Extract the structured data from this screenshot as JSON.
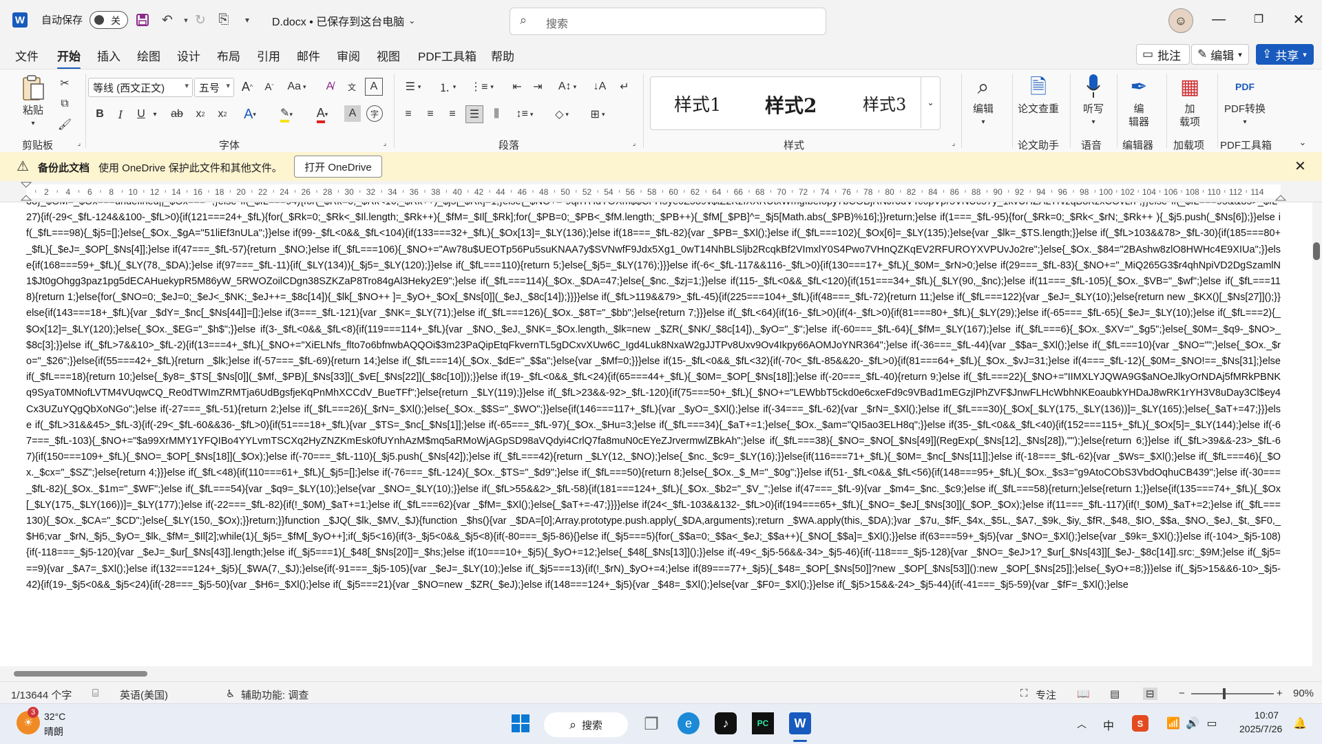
{
  "titlebar": {
    "app_letter": "W",
    "autosave_label": "自动保存",
    "autosave_state": "关",
    "doc_title": "D.docx • 已保存到这台电脑",
    "search_placeholder": "搜索"
  },
  "tabs": [
    "文件",
    "开始",
    "插入",
    "绘图",
    "设计",
    "布局",
    "引用",
    "邮件",
    "审阅",
    "视图",
    "PDF工具箱",
    "帮助"
  ],
  "active_tab": "开始",
  "right_buttons": {
    "comment": "批注",
    "edit": "编辑",
    "share": "共享"
  },
  "ribbon": {
    "paste": "粘贴",
    "font_name": "等线 (西文正文)",
    "font_size": "五号",
    "style_items": [
      "样式1",
      "样式2",
      "样式3"
    ],
    "edit_btn": "编辑",
    "paper_check": "论文查重",
    "dictate": "听写",
    "editor_line1": "编",
    "editor_line2": "辑器",
    "addins_line1": "加",
    "addins_line2": "载项",
    "pdf_convert": "PDF转换",
    "groups": {
      "clipboard": "剪贴板",
      "font": "字体",
      "paragraph": "段落",
      "styles": "样式",
      "paper": "论文助手",
      "voice": "语音",
      "editor": "编辑器",
      "addins": "加载项",
      "pdf": "PDF工具箱"
    }
  },
  "infobar": {
    "title": "备份此文档",
    "text": "使用 OneDrive 保护此文件和其他文件。",
    "button": "打开 OneDrive"
  },
  "ruler": {
    "labels": [
      "2",
      "4",
      "6",
      "8",
      "10",
      "12",
      "14",
      "16",
      "18",
      "20",
      "22",
      "24",
      "26",
      "28",
      "30",
      "32",
      "34",
      "36",
      "38",
      "40",
      "42",
      "44",
      "46",
      "48",
      "50",
      "52",
      "54",
      "56",
      "58",
      "60",
      "62",
      "64",
      "66",
      "68",
      "70",
      "72",
      "74",
      "76",
      "78",
      "80",
      "82",
      "84",
      "86",
      "88",
      "90",
      "92",
      "94",
      "96",
      "98",
      "100",
      "102",
      "104",
      "106",
      "108",
      "110",
      "112",
      "114"
    ]
  },
  "document": {
    "text": "38}_$OM=_$Ox===undefined||_$Ox===``;}else if(_$fL===94){for(_$Rk=0;_$Rk<16;_$Rk++)_$j5[_$Rk]=1;}else{_$NO+=\"9qnTHdYOXm$$CFH5ye0Z589v$tZ2KzIXXRUtxWmgIbeIopy7bCOBjRNJr3dVTc6pVpr5VNUc57y_1kvUHZALYrvzqB8KzxCOvLn\";}}else if(_$fL===95&&85>_$fL-27){if(-29<_$fL-124&&100-_$fL>0){if(121===24+_$fL){for(_$Rk=0;_$Rk<_$Il.length;_$Rk++){_$fM=_$Il[_$Rk];for(_$PB=0;_$PB<_$fM.length;_$PB++){_$fM[_$PB]^=_$j5[Math.abs(_$PB)%16];}}return;}else if(1===_$fL-95){for(_$Rk=0;_$Rk<_$rN;_$Rk++ ){_$j5.push(_$Ns[6]);}}else if(_$fL===98){_$j5=[];}else{_$Ox._$gA=\"51liEf3nULa\";}}else if(99-_$fL<0&&_$fL<104){if(133===32+_$fL){_$Ox[13]=_$LY(136);}else if(18===_$fL-82){var _$PB=_$Xl();}else if(_$fL===102){_$Ox[6]=_$LY(135);}else{var _$lk=_$TS.length;}}else if(_$fL>103&&78>_$fL-30){if(185===80+_$fL){_$eJ=_$OP[_$Ns[4]];}else if(47===_$fL-57){return _$NO;}else if(_$fL===106){_$NO+=\"Aw78u$UEOTp56Pu5suKNAA7y$SVNwfF9Jdx5Xg1_0wT14NhBLSljb2RcqkBf2VImxlY0S4Pwo7VHnQZKqEV2RFUROYXVPUvJo2re\";}else{_$Ox._$84=\"2BAshw8zlO8HWHc4E9XIUa\";}}else{if(168===59+_$fL){_$LY(78,_$DA);}else if(97===_$fL-11){if(_$LY(134)){_$j5=_$LY(120);}}else if(_$fL===110){return 5;}else{_$j5=_$LY(176);}}}else if(-6<_$fL-117&&116-_$fL>0){if(130===17+_$fL){_$0M=_$rN>0;}else if(29===_$fL-83){_$NO+=\"_MiQ265G3$r4qhNpiVD2DgSzamlN1$Jt0gOhgg3paz1pg5dECAHuekypR5M86yW_5RWOZoilCDgn38SZKZaP8Tro84gAl3Heky2E9\";}else if(_$fL===114){_$Ox._$DA=47;}else{_$nc._$zj=1;}}else if(115-_$fL<0&&_$fL<120){if(151===34+_$fL){_$LY(90,_$nc);}else if(11===_$fL-105){_$Ox._$VB=\"_$wf\";}else if(_$fL===118){return 1;}else{for(_$NO=0;_$eJ=0;_$eJ<_$NK;_$eJ++=_$8c[14]){_$lk[_$NO++ ]=_$yO+_$Ox[_$Ns[0]](_$eJ,_$8c[14]);}}}}else if(_$fL>119&&79>_$fL-45){if(225===104+_$fL){if(48===_$fL-72){return 11;}else if(_$fL===122){var _$eJ=_$LY(10);}else{return new _$KX()[_$Ns[27]]();}}else{if(143===18+_$fL){var _$dY=_$nc[_$Ns[44]]=[];}else if(3===_$fL-121){var _$NK=_$LY(71);}else if(_$fL===126){_$Ox._$8T=\"_$bb\";}else{return 7;}}}else if(_$fL<64){if(16-_$fL>0){if(4-_$fL>0){if(81===80+_$fL){_$LY(29);}else if(-65===_$fL-65){_$eJ=_$LY(10);}else if(_$fL===2){_$Ox[12]=_$LY(120);}else{_$Ox._$EG=\"_$h$\";}}else if(3-_$fL<0&&_$fL<8){if(119===114+_$fL){var _$NO,_$eJ,_$NK=_$Ox.length,_$lk=new _$ZR(_$NK/_$8c[14]),_$yO=\"_$\";}else if(-60===_$fL-64){_$fM=_$LY(167);}else if(_$fL===6){_$Ox._$XV=\"_$g5\";}else{_$0M=_$q9-_$NO>_$8c[3];}}else if(_$fL>7&&10>_$fL-2){if(13===4+_$fL){_$NO+=\"XiELNfs_flto7o6bfnwbAQQOi$3m23PaQipEtqFkvernTL5gDCxvXUw6C_Igd4Luk8NxaW2gJJTPv8Uxv9Ov4Ikpy66AOMJoYNR364\";}else if(-36===_$fL-44){var _$$a=_$Xl();}else if(_$fL===10){var _$NO=\"\";}else{_$Ox._$ro=\"_$26\";}}else{if(55===42+_$fL){return _$lk;}else if(-57===_$fL-69){return 14;}else if(_$fL===14){_$Ox._$dE=\"_$$a\";}else{var _$Mf=0;}}}else if(15-_$fL<0&&_$fL<32){if(-70<_$fL-85&&20-_$fL>0){if(81===64+_$fL){_$Ox._$vJ=31;}else if(4===_$fL-12){_$0M=_$NO!==_$Ns[31];}else if(_$fL===18){return 10;}else{_$y8=_$TS[_$Ns[0]](_$Mf,_$PB)[_$Ns[33]](_$vE[_$Ns[22]](_$8c[10]));}}else if(19-_$fL<0&&_$fL<24){if(65===44+_$fL){_$0M=_$OP[_$Ns[18]];}else if(-20===_$fL-40){return 9;}else if(_$fL===22){_$NO+=\"IIMXLYJQWA9G$aNOeJlkyOrNDAj5fMRkPBNKq9SyaT0MNofLVTM4VUqwCQ_Re0dTWImZRMTja6UdBgsfjeKqPnMhXCCdV_BueTFf\";}else{return _$LY(119);}}else if(_$fL>23&&-92>_$fL-120){if(75===50+_$fL){_$NO+=\"LEWbbT5ckd0e6cxeFd9c9VBad1mEGzjlPhZVF$JnwFLHcWbhNKEoaubkYHDaJ8wRK1rYH3V8uDay3Cl$ey4Cx3UZuYQgQbXoNGo\";}else if(-27===_$fL-51){return 2;}else if(_$fL===26){_$rN=_$Xl();}else{_$Ox._$$S=\"_$WO\";}}else{if(146===117+_$fL){var _$yO=_$Xl();}else if(-34===_$fL-62){var _$rN=_$Xl();}else if(_$fL===30){_$Ox[_$LY(175,_$LY(136))]=_$LY(165);}else{_$aT+=47;}}}else if(_$fL>31&&45>_$fL-3){if(-29<_$fL-60&&36-_$fL>0){if(51===18+_$fL){var _$TS=_$nc[_$Ns[1]];}else if(-65===_$fL-97){_$Ox._$Hu=3;}else if(_$fL===34){_$aT+=1;}else{_$Ox._$am=\"QI5ao3ELH8q\";}}else if(35-_$fL<0&&_$fL<40){if(152===115+_$fL){_$Ox[5]=_$LY(144);}else if(-67===_$fL-103){_$NO+=\"$a99XrMMY1YFQIBo4YYLvmTSCXq2HyZNZKmEsk0fUYnhAzM$mq5aRMoWjAGpSD98aVQdyi4CrlQ7fa8muN0cEYeZJrvermwlZBkAh\";}else if(_$fL===38){_$NO=_$NO[_$Ns[49]](RegExp(_$Ns[12],_$Ns[28]),\"\");}else{return 6;}}else if(_$fL>39&&-23>_$fL-67){if(150===109+_$fL){_$NO=_$OP[_$Ns[18]](_$Ox);}else if(-70===_$fL-110){_$j5.push(_$Ns[42]);}else if(_$fL===42){return _$LY(12,_$NO);}else{_$nc._$c9=_$LY(16);}}else{if(116===71+_$fL){_$0M=_$nc[_$Ns[11]];}else if(-18===_$fL-62){var _$Ws=_$Xl();}else if(_$fL===46){_$Ox._$cx=\"_$SZ\";}else{return 4;}}}else if(_$fL<48){if(110===61+_$fL){_$j5=[];}else if(-76===_$fL-124){_$Ox._$TS=\"_$d9\";}else if(_$fL===50){return 8;}else{_$Ox._$_M=\"_$0g\";}}else if(51-_$fL<0&&_$fL<56){if(148===95+_$fL){_$Ox._$s3=\"g9AtoCObS3VbdOqhuCB439\";}else if(-30===_$fL-82){_$Ox._$1m=\"_$WF\";}else if(_$fL===54){var _$q9=_$LY(10);}else{var _$NO=_$LY(10);}}else if(_$fL>55&&2>_$fL-58){if(181===124+_$fL){_$Ox._$b2=\"_$V_\";}else if(47===_$fL-9){var _$m4=_$nc._$c9;}else if(_$fL===58){return;}else{return 1;}}else{if(135===74+_$fL){_$Ox[_$LY(175,_$LY(166))]=_$LY(177);}else if(-22===_$fL-82){if(!_$0M)_$aT+=1;}else if(_$fL===62){var _$fM=_$Xl();}else{_$aT+=-47;}}}}else if(24<_$fL-103&&132-_$fL>0){if(194===65+_$fL){_$NO=_$eJ[_$Ns[30]](_$OP._$Ox);}else if(11===_$fL-117){if(!_$0M)_$aT+=2;}else if(_$fL===130){_$Ox._$CA=\"_$CD\";}else{_$LY(150,_$Ox);}}return;}}function _$JQ(_$lk,_$MV,_$J){function _$hs(){var _$DA=[0];Array.prototype.push.apply(_$DA,arguments);return _$WA.apply(this,_$DA);}var _$7u,_$fF,_$4x,_$5L,_$A7,_$9k,_$iy,_$fR,_$48,_$IO,_$$a,_$NO,_$eJ,_$t,_$F0,_$H6;var _$rN,_$j5,_$yO=_$lk,_$fM=_$Il[2];while(1){_$j5=_$fM[_$yO++];if(_$j5<16){if(3-_$j5<0&&_$j5<8){if(-80===_$j5-86){}else if(_$j5===5){for(_$$a=0;_$$a<_$eJ;_$$a++){_$NO[_$$a]=_$Xl();}}else if(63===59+_$j5){var _$NO=_$Xl();}else{var _$9k=_$Xl();}}else if(-104>_$j5-108){if(-118===_$j5-120){var _$eJ=_$ur[_$Ns[43]].length;}else if(_$j5===1){_$48[_$Ns[20]]=_$hs;}else if(10===10+_$j5){_$yO+=12;}else{_$48[_$Ns[13]]();}}else if(-49<_$j5-56&&-34>_$j5-46){if(-118===_$j5-128){var _$NO=_$eJ>1?_$ur[_$Ns[43]][_$eJ-_$8c[14]].src:_$9M;}else if(_$j5===9){var _$A7=_$Xl();}else if(132===124+_$j5){_$WA(7,_$J);}else{if(-91===_$j5-105){var _$eJ=_$LY(10);}else if(_$j5===13){if(!_$rN)_$yO+=4;}else if(89===77+_$j5){_$48=_$OP[_$Ns[50]]?new _$OP[_$Ns[53]]():new _$OP[_$Ns[25]];}else{_$yO+=8;}}}else if(_$j5>15&&6-10>_$j5-42){if(19-_$j5<0&&_$j5<24){if(-28===_$j5-50){var _$H6=_$Xl();}else if(_$j5===21){var _$NO=new _$ZR(_$eJ);}else if(148===124+_$j5){var _$48=_$Xl();}else{var _$F0=_$Xl();}}else if(_$j5>15&&-24>_$j5-44){if(-41===_$j5-59){var _$fF=_$Xl();}else"
  },
  "statusbar": {
    "word_count": "1/13644 个字",
    "language": "英语(美国)",
    "accessibility": "辅助功能: 调查",
    "focus": "专注",
    "zoom": "90%"
  },
  "taskbar": {
    "weather_temp": "32°C",
    "weather_desc": "晴朗",
    "weather_badge": "3",
    "search_label": "搜索",
    "ime": "中",
    "time": "10:07",
    "date": "2025/7/26"
  }
}
